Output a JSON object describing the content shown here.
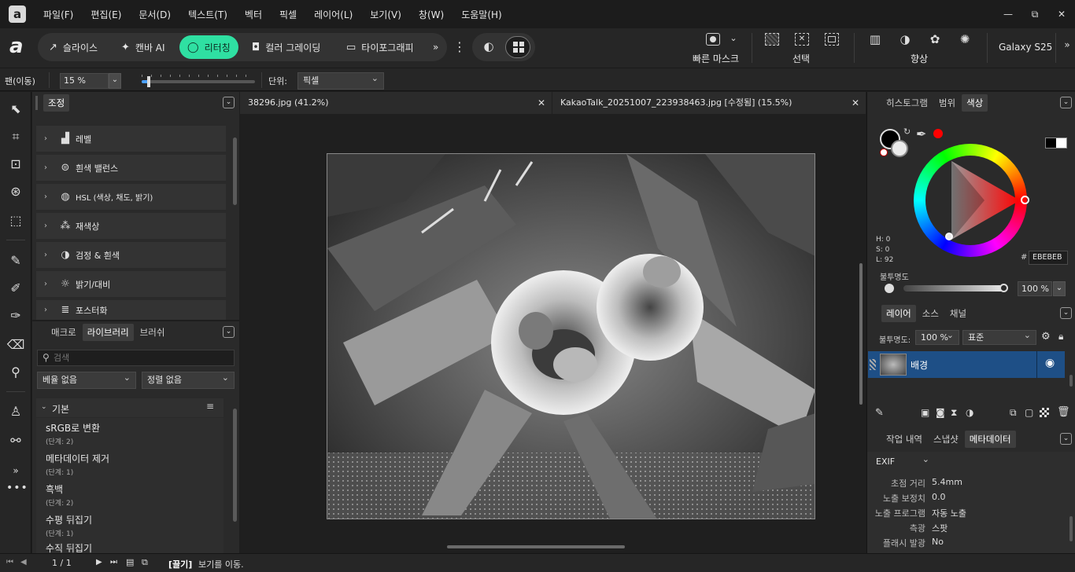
{
  "menu": {
    "items": [
      "파일(F)",
      "편집(E)",
      "문서(D)",
      "텍스트(T)",
      "벡터",
      "픽셀",
      "레이어(L)",
      "보기(V)",
      "창(W)",
      "도움말(H)"
    ]
  },
  "window": {
    "minimize": "—",
    "restore": "⧉",
    "close": "✕"
  },
  "personas": {
    "slice": "슬라이스",
    "canva_ai": "캔바 AI",
    "retouch": "리터칭",
    "color_grading": "컬러 그레이딩",
    "typography": "타이포그래피",
    "more": "»"
  },
  "toolbar": {
    "quick_mask": "빠른 마스크",
    "selection": "선택",
    "enhance": "향상",
    "device": "Galaxy S25"
  },
  "context": {
    "tool": "팬(이동)",
    "zoom": "15 %",
    "unit_label": "단위:",
    "unit_value": "픽셀",
    "zoom_slider_fraction": 0.06
  },
  "adjustments": {
    "tab": "조정",
    "items": [
      "레벨",
      "흰색 밸런스",
      "HSL (색상, 채도, 밝기)",
      "재색상",
      "검정 & 흰색",
      "밝기/대비",
      "포스터화"
    ]
  },
  "library": {
    "tabs": [
      "매크로",
      "라이브러리",
      "브러쉬"
    ],
    "active_tab": "라이브러리",
    "search_placeholder": "검색",
    "category": "베율 없음",
    "sort": "정렬 없음",
    "group": "기본",
    "macros": [
      {
        "name": "sRGB로 변환",
        "steps": "(단계: 2)"
      },
      {
        "name": "메타데이터 제거",
        "steps": "(단계: 1)"
      },
      {
        "name": "흑백",
        "steps": "(단계: 2)"
      },
      {
        "name": "수평 뒤집기",
        "steps": "(단계: 1)"
      },
      {
        "name": "수직 뒤집기",
        "steps": ""
      }
    ]
  },
  "documents": {
    "tabs": [
      {
        "title": "38296.jpg (41.2%)"
      },
      {
        "title": "KakaoTalk_20251007_223938463.jpg [수정됨] (15.5%)"
      }
    ]
  },
  "color_panel": {
    "tabs": [
      "히스토그램",
      "범위",
      "색상"
    ],
    "active_tab": "색상",
    "h": "H: 0",
    "s": "S: 0",
    "l": "L: 92",
    "hex_label": "#",
    "hex": "EBEBEB",
    "opacity_label": "불투명도",
    "opacity": "100 %",
    "opacity_fraction": 1.0,
    "accent_red": "#ff0000"
  },
  "layers": {
    "tabs": [
      "레이어",
      "소스",
      "채널"
    ],
    "active_tab": "레이어",
    "opacity_label": "불투명도:",
    "opacity": "100 %",
    "blend": "표준",
    "items": [
      {
        "name": "배경"
      }
    ]
  },
  "history": {
    "tabs": [
      "작업 내역",
      "스냅샷",
      "메타데이터"
    ],
    "active_tab": "메타데이터",
    "exif": "EXIF",
    "rows": [
      {
        "key": "초점 거리",
        "value": "5.4mm"
      },
      {
        "key": "노출 보정치",
        "value": "0.0"
      },
      {
        "key": "노출 프로그램",
        "value": "자동 노출"
      },
      {
        "key": "측광",
        "value": "스팟"
      },
      {
        "key": "플래시 발광",
        "value": "No"
      }
    ]
  },
  "status": {
    "page": "1 / 1",
    "hint_bold": "[끌기]",
    "hint": "보기를 이동."
  },
  "colors": {
    "accent": "#2fe0a2",
    "layer_selected": "#1e4f86"
  }
}
